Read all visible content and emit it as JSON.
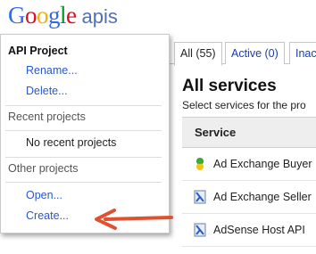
{
  "logo": {
    "google": [
      "G",
      "o",
      "o",
      "g",
      "l",
      "e"
    ],
    "apis": "apis"
  },
  "tabs": [
    {
      "label": "All (55)",
      "active": true
    },
    {
      "label": "Active (0)",
      "active": false
    },
    {
      "label": "Inac",
      "active": false
    }
  ],
  "main": {
    "heading": "All services",
    "subheading": "Select services for the pro"
  },
  "table": {
    "column_header": "Service",
    "rows": [
      {
        "name": "Ad Exchange Buyer",
        "icon": "ad-exchange-buyer-icon"
      },
      {
        "name": "Ad Exchange Seller",
        "icon": "ad-exchange-seller-icon"
      },
      {
        "name": "AdSense Host API",
        "icon": "adsense-host-icon"
      }
    ]
  },
  "menu": {
    "project_title": "API Project",
    "rename": "Rename...",
    "delete": "Delete...",
    "recent_label": "Recent projects",
    "no_recent": "No recent projects",
    "other_label": "Other projects",
    "open": "Open...",
    "create": "Create..."
  },
  "colors": {
    "link": "#2a58c8",
    "arrow": "#e0512f",
    "header_bg": "#eeeeee"
  }
}
